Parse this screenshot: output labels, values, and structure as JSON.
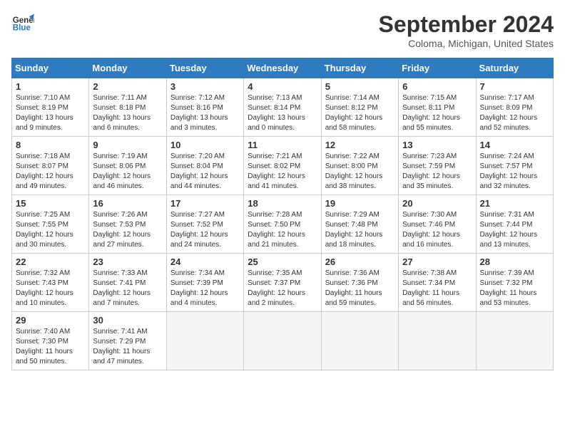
{
  "header": {
    "logo_line1": "General",
    "logo_line2": "Blue",
    "month": "September 2024",
    "location": "Coloma, Michigan, United States"
  },
  "weekdays": [
    "Sunday",
    "Monday",
    "Tuesday",
    "Wednesday",
    "Thursday",
    "Friday",
    "Saturday"
  ],
  "weeks": [
    [
      {
        "day": "1",
        "sunrise": "7:10 AM",
        "sunset": "8:19 PM",
        "daylight": "13 hours and 9 minutes."
      },
      {
        "day": "2",
        "sunrise": "7:11 AM",
        "sunset": "8:18 PM",
        "daylight": "13 hours and 6 minutes."
      },
      {
        "day": "3",
        "sunrise": "7:12 AM",
        "sunset": "8:16 PM",
        "daylight": "13 hours and 3 minutes."
      },
      {
        "day": "4",
        "sunrise": "7:13 AM",
        "sunset": "8:14 PM",
        "daylight": "13 hours and 0 minutes."
      },
      {
        "day": "5",
        "sunrise": "7:14 AM",
        "sunset": "8:12 PM",
        "daylight": "12 hours and 58 minutes."
      },
      {
        "day": "6",
        "sunrise": "7:15 AM",
        "sunset": "8:11 PM",
        "daylight": "12 hours and 55 minutes."
      },
      {
        "day": "7",
        "sunrise": "7:17 AM",
        "sunset": "8:09 PM",
        "daylight": "12 hours and 52 minutes."
      }
    ],
    [
      {
        "day": "8",
        "sunrise": "7:18 AM",
        "sunset": "8:07 PM",
        "daylight": "12 hours and 49 minutes."
      },
      {
        "day": "9",
        "sunrise": "7:19 AM",
        "sunset": "8:06 PM",
        "daylight": "12 hours and 46 minutes."
      },
      {
        "day": "10",
        "sunrise": "7:20 AM",
        "sunset": "8:04 PM",
        "daylight": "12 hours and 44 minutes."
      },
      {
        "day": "11",
        "sunrise": "7:21 AM",
        "sunset": "8:02 PM",
        "daylight": "12 hours and 41 minutes."
      },
      {
        "day": "12",
        "sunrise": "7:22 AM",
        "sunset": "8:00 PM",
        "daylight": "12 hours and 38 minutes."
      },
      {
        "day": "13",
        "sunrise": "7:23 AM",
        "sunset": "7:59 PM",
        "daylight": "12 hours and 35 minutes."
      },
      {
        "day": "14",
        "sunrise": "7:24 AM",
        "sunset": "7:57 PM",
        "daylight": "12 hours and 32 minutes."
      }
    ],
    [
      {
        "day": "15",
        "sunrise": "7:25 AM",
        "sunset": "7:55 PM",
        "daylight": "12 hours and 30 minutes."
      },
      {
        "day": "16",
        "sunrise": "7:26 AM",
        "sunset": "7:53 PM",
        "daylight": "12 hours and 27 minutes."
      },
      {
        "day": "17",
        "sunrise": "7:27 AM",
        "sunset": "7:52 PM",
        "daylight": "12 hours and 24 minutes."
      },
      {
        "day": "18",
        "sunrise": "7:28 AM",
        "sunset": "7:50 PM",
        "daylight": "12 hours and 21 minutes."
      },
      {
        "day": "19",
        "sunrise": "7:29 AM",
        "sunset": "7:48 PM",
        "daylight": "12 hours and 18 minutes."
      },
      {
        "day": "20",
        "sunrise": "7:30 AM",
        "sunset": "7:46 PM",
        "daylight": "12 hours and 16 minutes."
      },
      {
        "day": "21",
        "sunrise": "7:31 AM",
        "sunset": "7:44 PM",
        "daylight": "12 hours and 13 minutes."
      }
    ],
    [
      {
        "day": "22",
        "sunrise": "7:32 AM",
        "sunset": "7:43 PM",
        "daylight": "12 hours and 10 minutes."
      },
      {
        "day": "23",
        "sunrise": "7:33 AM",
        "sunset": "7:41 PM",
        "daylight": "12 hours and 7 minutes."
      },
      {
        "day": "24",
        "sunrise": "7:34 AM",
        "sunset": "7:39 PM",
        "daylight": "12 hours and 4 minutes."
      },
      {
        "day": "25",
        "sunrise": "7:35 AM",
        "sunset": "7:37 PM",
        "daylight": "12 hours and 2 minutes."
      },
      {
        "day": "26",
        "sunrise": "7:36 AM",
        "sunset": "7:36 PM",
        "daylight": "11 hours and 59 minutes."
      },
      {
        "day": "27",
        "sunrise": "7:38 AM",
        "sunset": "7:34 PM",
        "daylight": "11 hours and 56 minutes."
      },
      {
        "day": "28",
        "sunrise": "7:39 AM",
        "sunset": "7:32 PM",
        "daylight": "11 hours and 53 minutes."
      }
    ],
    [
      {
        "day": "29",
        "sunrise": "7:40 AM",
        "sunset": "7:30 PM",
        "daylight": "11 hours and 50 minutes."
      },
      {
        "day": "30",
        "sunrise": "7:41 AM",
        "sunset": "7:29 PM",
        "daylight": "11 hours and 47 minutes."
      },
      null,
      null,
      null,
      null,
      null
    ]
  ]
}
